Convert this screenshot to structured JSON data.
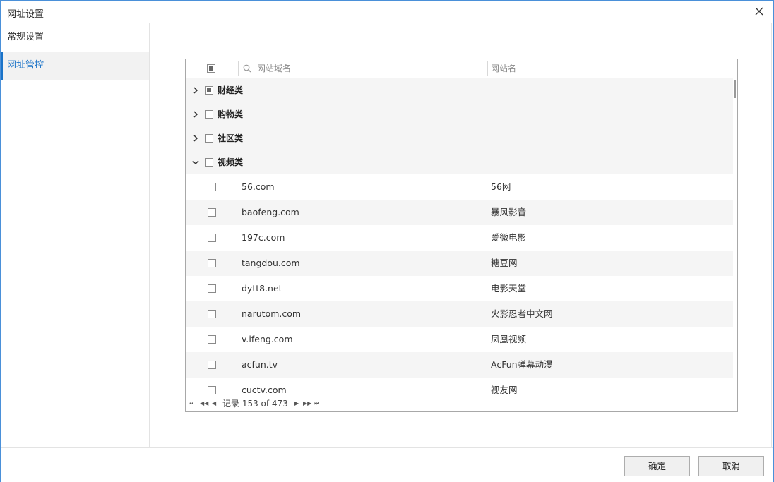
{
  "window": {
    "title": "网址设置"
  },
  "sidebar": {
    "items": [
      {
        "label": "常规设置",
        "active": false
      },
      {
        "label": "网址管控",
        "active": true
      }
    ]
  },
  "grid": {
    "header": {
      "search_placeholder": "网站域名",
      "col_name": "网站名"
    },
    "groups": [
      {
        "label": "财经类",
        "expanded": false,
        "state": "partial"
      },
      {
        "label": "购物类",
        "expanded": false,
        "state": "unchecked"
      },
      {
        "label": "社区类",
        "expanded": false,
        "state": "unchecked"
      },
      {
        "label": "视频类",
        "expanded": true,
        "state": "unchecked"
      }
    ],
    "rows": [
      {
        "domain": "56.com",
        "name": "56网"
      },
      {
        "domain": "baofeng.com",
        "name": "暴风影音"
      },
      {
        "domain": "197c.com",
        "name": "爱微电影"
      },
      {
        "domain": "tangdou.com",
        "name": "糖豆网"
      },
      {
        "domain": "dytt8.net",
        "name": "电影天堂"
      },
      {
        "domain": "narutom.com",
        "name": "火影忍者中文网"
      },
      {
        "domain": "v.ifeng.com",
        "name": "凤凰视频"
      },
      {
        "domain": "acfun.tv",
        "name": "AcFun弹幕动漫"
      },
      {
        "domain": "cuctv.com",
        "name": "视友网"
      }
    ],
    "pager": {
      "record_text": "记录 153 of 473"
    }
  },
  "footer": {
    "ok_label": "确定",
    "cancel_label": "取消"
  },
  "colors": {
    "accent": "#1a73c8",
    "group_bg": "#f5f5f5"
  }
}
